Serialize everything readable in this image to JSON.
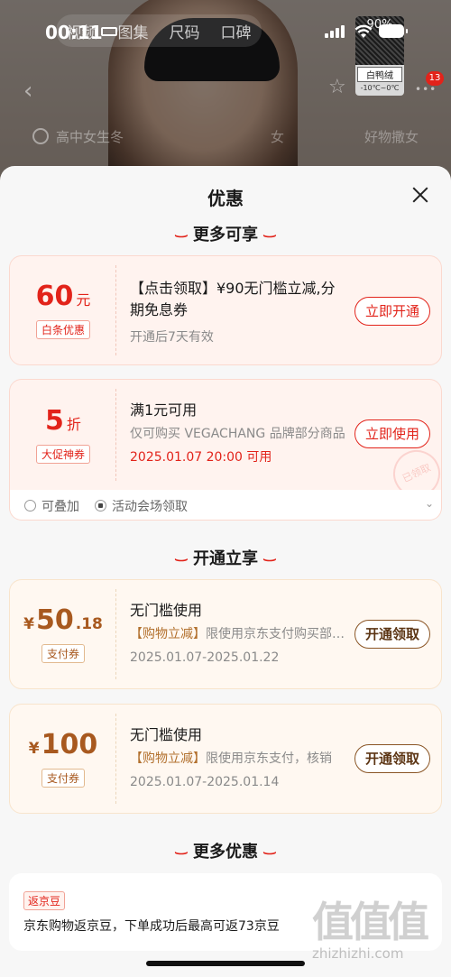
{
  "status_bar": {
    "time": "00:11"
  },
  "background": {
    "media_tabs": [
      "视频",
      "图集",
      "尺码",
      "口碑"
    ],
    "thumbnail": {
      "label": "白鸭绒",
      "top_text": "90%",
      "temp": "-10℃~0℃"
    },
    "cart_badge": "13",
    "search_hint": "高中女生冬",
    "search_hint_right": "女",
    "search_hint_far": "好物撒女"
  },
  "sheet": {
    "title": "优惠",
    "sections": {
      "more_available": "更多可享",
      "open_enjoy": "开通立享",
      "more_discounts": "更多优惠"
    },
    "coupons": [
      {
        "amount": "60",
        "unit": "元",
        "tag": "白条优惠",
        "title": "【点击领取】¥90无门槛立减,分期免息券",
        "sub": "开通后7天有效",
        "button": "立即开通"
      },
      {
        "amount": "5",
        "unit": "折",
        "tag": "大促神券",
        "title": "满1元可用",
        "sub": "仅可购买 VEGACHANG 品牌部分商品",
        "date": "2025.01.07 20:00 可用",
        "button": "立即使用",
        "stamp": "已领取",
        "footer": {
          "stackable": "可叠加",
          "venue": "活动会场领取"
        }
      },
      {
        "currency": "¥",
        "amount": "50",
        "decimal": ".18",
        "tag": "支付券",
        "title": "无门槛使用",
        "sub_highlight": "【购物立减】",
        "sub": "限使用京东支付购买部分商品",
        "date": "2025.01.07-2025.01.22",
        "button": "开通领取"
      },
      {
        "currency": "¥",
        "amount": "100",
        "tag": "支付券",
        "title": "无门槛使用",
        "sub_highlight": "【购物立减】",
        "sub": "限使用京东支付，核销",
        "date": "2025.01.07-2025.01.14",
        "button": "开通领取"
      }
    ],
    "jd_beans": {
      "tag": "返京豆",
      "text": "京东购物返京豆，下单成功后最高可返73京豆"
    }
  },
  "watermark": {
    "logo": "值值值",
    "url": "zhizhizhi.com"
  },
  "colors": {
    "accent_red": "#e2231a",
    "pay_brown": "#a8591f",
    "sheet_bg": "#f7f7f7"
  },
  "icons": [
    "sleep-icon",
    "signal-icon",
    "wifi-icon",
    "battery-icon",
    "back-icon",
    "star-icon",
    "search-icon",
    "close-icon",
    "stack-icon",
    "venue-icon",
    "chevron-down-icon"
  ]
}
